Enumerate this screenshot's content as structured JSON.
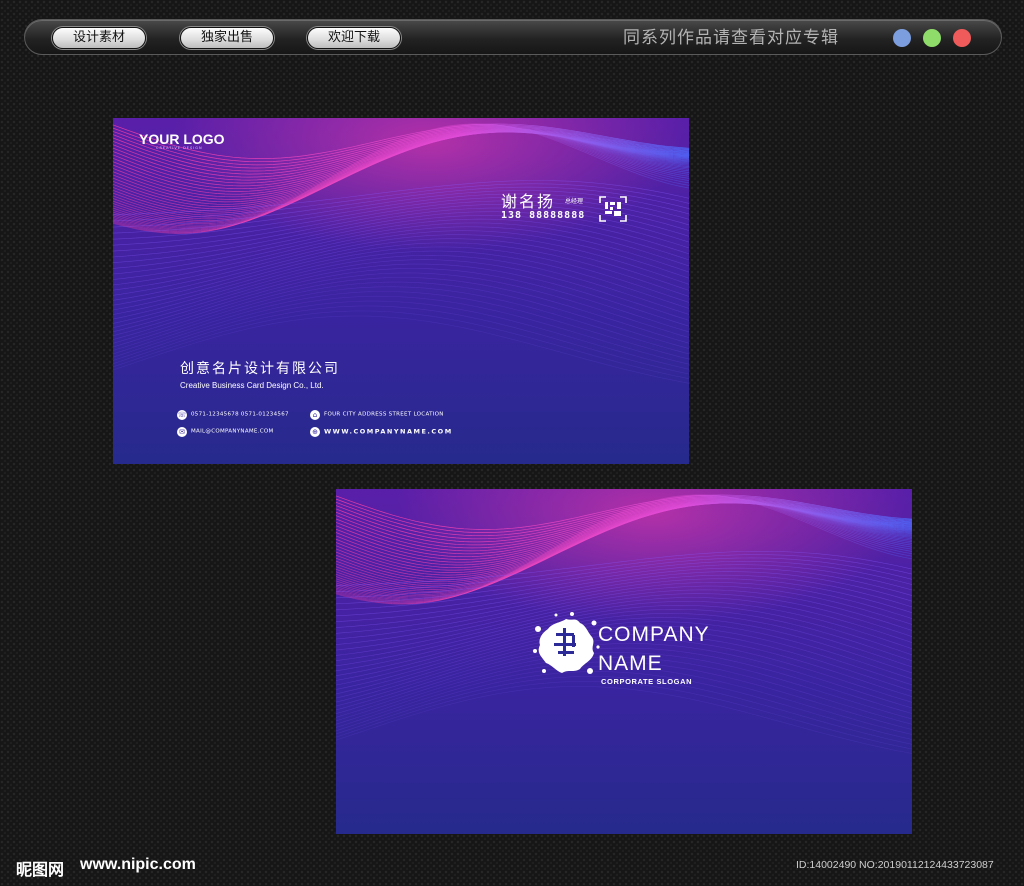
{
  "toolbar": {
    "buttons": [
      "设计素材",
      "独家出售",
      "欢迎下载"
    ],
    "title": "同系列作品请查看对应专辑",
    "dot_colors": [
      "#7d9ede",
      "#8fdc6a",
      "#ef5b5b"
    ]
  },
  "front_card": {
    "logo": "YOUR LOGO",
    "logo_sub": "CREATIVE DESIGN",
    "name": "谢名扬",
    "job_title": "总经理",
    "phone": "138 88888888",
    "company_cn": "创意名片设计有限公司",
    "company_en": "Creative Business Card Design Co., Ltd.",
    "phones": "0571-12345678    0571-01234567",
    "address": "FOUR CITY ADDRESS STREET LOCATION",
    "email": "MAIL@COMPANYNAME.COM",
    "website": "WWW.COMPANYNAME.COM"
  },
  "back_card": {
    "company_line1": "COMPANY",
    "company_line2": "NAME",
    "slogan": "CORPORATE SLOGAN"
  },
  "watermark": {
    "logo": "昵图网",
    "site": "www.nipic.com",
    "id": "ID:14002490 NO:20190112124433723087"
  },
  "colors": {
    "card_top": "#5a1fa8",
    "card_bottom": "#262a8c",
    "wave_pink": "#ff3ea0",
    "wave_blue": "#4c6cff"
  }
}
